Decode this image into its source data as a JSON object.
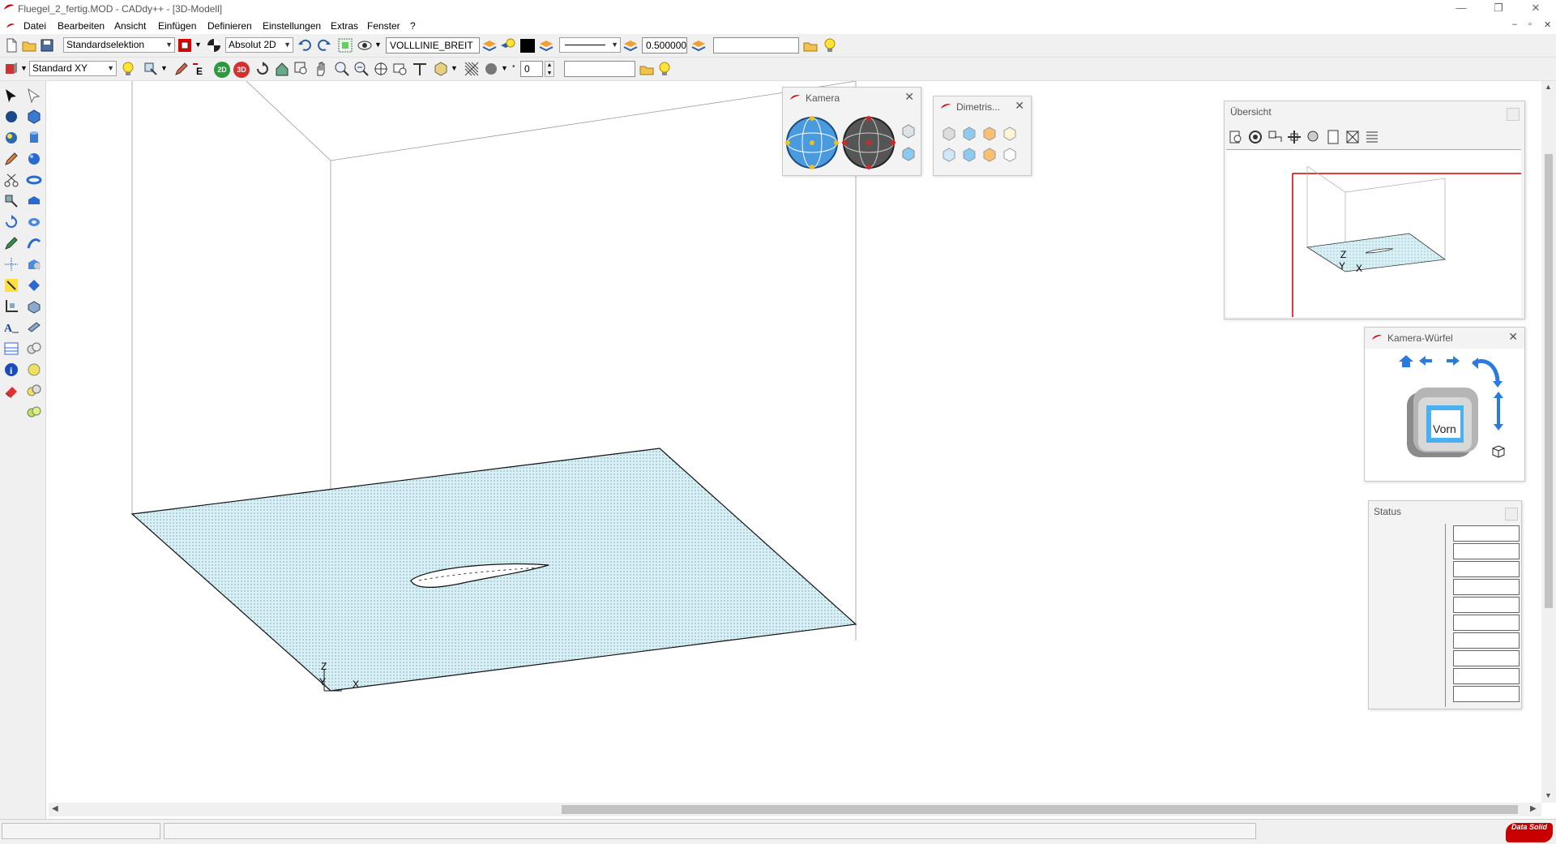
{
  "app": {
    "title": "Fluegel_2_fertig.MOD  -  CADdy++ - [3D-Modell]",
    "window_buttons": {
      "minimize": "—",
      "restore": "❐",
      "close": "✕"
    },
    "mdi_buttons": {
      "minimize": "–",
      "restore": "▫",
      "close": "✕"
    }
  },
  "menu": {
    "items": [
      "Datei",
      "Bearbeiten",
      "Ansicht",
      "Einfügen",
      "Definieren",
      "Einstellungen",
      "Extras",
      "Fenster",
      "?"
    ]
  },
  "toolbar1": {
    "selection_mode": "Standardselektion",
    "coord_mode": "Absolut 2D",
    "line_type": "VOLLLINIE_BREIT",
    "line_width": "0.500000",
    "layer_field": ""
  },
  "toolbar2": {
    "view_plane": "Standard XY",
    "btn_2d": "2D",
    "btn_3d": "3D",
    "grid_value": "0",
    "extra_field": ""
  },
  "canvas": {
    "axis_labels": {
      "z": "Z",
      "y": "Y",
      "x": "X"
    }
  },
  "panels": {
    "kamera": {
      "title": "Kamera"
    },
    "dimetrie": {
      "title": "Dimetris..."
    },
    "uebersicht": {
      "title": "Übersicht",
      "axis_labels": {
        "z": "Z",
        "y": "Y",
        "x": "X"
      }
    },
    "kamera_wuerfel": {
      "title": "Kamera-Würfel",
      "cube_face": "Vorn"
    },
    "status": {
      "title": "Status",
      "rows": [
        "",
        "",
        "",
        "",
        "",
        "",
        "",
        "",
        "",
        ""
      ]
    }
  },
  "colors": {
    "accent_red": "#cc0000",
    "plate_fill": "#d6f0f5",
    "panel_bg": "#f3f3f3",
    "toolbar_bg": "#f0f0f0"
  },
  "branding": {
    "logo_text": "Data Solid"
  }
}
